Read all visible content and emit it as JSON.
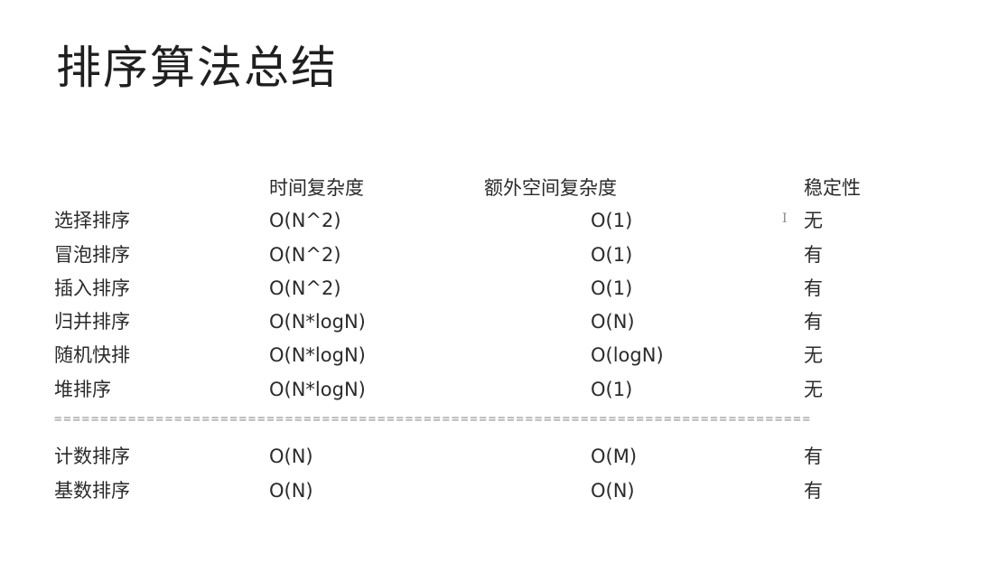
{
  "title": "排序算法总结",
  "headers": {
    "time": "时间复杂度",
    "space": "额外空间复杂度",
    "stable": "稳定性"
  },
  "rows": [
    {
      "name": "选择排序",
      "time": "O(N^2)",
      "space": "O(1)",
      "stable": "无"
    },
    {
      "name": "冒泡排序",
      "time": "O(N^2)",
      "space": "O(1)",
      "stable": "有"
    },
    {
      "name": "插入排序",
      "time": "O(N^2)",
      "space": "O(1)",
      "stable": "有"
    },
    {
      "name": "归并排序",
      "time": "O(N*logN)",
      "space": "O(N)",
      "stable": "有"
    },
    {
      "name": "随机快排",
      "time": "O(N*logN)",
      "space": "O(logN)",
      "stable": "无"
    },
    {
      "name": "堆排序",
      "time": "O(N*logN)",
      "space": "O(1)",
      "stable": "无"
    }
  ],
  "divider": "==================================================================================",
  "rows2": [
    {
      "name": "计数排序",
      "time": "O(N)",
      "space": "O(M)",
      "stable": "有"
    },
    {
      "name": "基数排序",
      "time": "O(N)",
      "space": "O(N)",
      "stable": "有"
    }
  ]
}
